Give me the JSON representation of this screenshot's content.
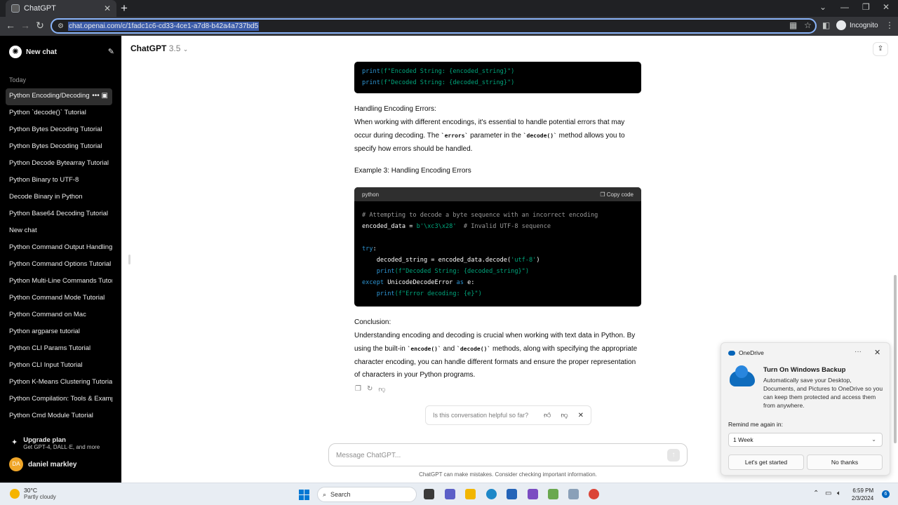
{
  "browser": {
    "tab_title": "ChatGPT",
    "url": "chat.openai.com/c/1fadc1c6-cd33-4ce1-a7d8-b42a4a737bd5",
    "incognito_label": "Incognito"
  },
  "sidebar": {
    "new_chat": "New chat",
    "section": "Today",
    "items": [
      "Python Encoding/Decoding",
      "Python `decode()` Tutorial",
      "Python Bytes Decoding Tutorial",
      "Python Bytes Decoding Tutorial",
      "Python Decode Bytearray Tutorial",
      "Python Binary to UTF-8",
      "Decode Binary in Python",
      "Python Base64 Decoding Tutorial",
      "New chat",
      "Python Command Output Handling",
      "Python Command Options Tutorial",
      "Python Multi-Line Commands Tutorial",
      "Python Command Mode Tutorial",
      "Python Command on Mac",
      "Python argparse tutorial",
      "Python CLI Params Tutorial",
      "Python CLI Input Tutorial",
      "Python K-Means Clustering Tutorial",
      "Python Compilation: Tools & Examples",
      "Python Cmd Module Tutorial"
    ],
    "upgrade_title": "Upgrade plan",
    "upgrade_sub": "Get GPT-4, DALL·E, and more",
    "user_initials": "DA",
    "user_name": "daniel markley"
  },
  "header": {
    "model": "ChatGPT",
    "version": "3.5"
  },
  "chat": {
    "code_top": {
      "line1_fn": "print",
      "line1_str": "(f\"Encoded String: {encoded_string}\")",
      "line2_fn": "print",
      "line2_str": "(f\"Decoded String: {decoded_string}\")"
    },
    "heading_errors": "Handling Encoding Errors:",
    "para_errors_1": "When working with different encodings, it's essential to handle potential errors that may occur during decoding. The ",
    "code_errors": "`errors`",
    "para_errors_2": " parameter in the ",
    "code_decode": "`decode()`",
    "para_errors_3": " method allows you to specify how errors should be handled.",
    "example3": "Example 3: Handling Encoding Errors",
    "code_block": {
      "language": "python",
      "copy_label": "Copy code",
      "comment": "# Attempting to decode a byte sequence with an incorrect encoding",
      "l2_var": "encoded_data = ",
      "l2_str": "b'\\xc3\\x28'",
      "l2_cm": "  # Invalid UTF-8 sequence",
      "l4_kw": "try",
      "l4_rest": ":",
      "l5_a": "    decoded_string = encoded_data.decode(",
      "l5_str": "'utf-8'",
      "l5_b": ")",
      "l6_fn": "    print",
      "l6_str": "(f\"Decoded String: {decoded_string}\")",
      "l7_kw": "except",
      "l7_mid": " UnicodeDecodeError ",
      "l7_kw2": "as",
      "l7_end": " e:",
      "l8_fn": "    print",
      "l8_str": "(f\"Error decoding: {e}\")"
    },
    "conclusion": "Conclusion:",
    "concl_1": "Understanding encoding and decoding is crucial when working with text data in Python. By using the built-in ",
    "concl_code1": "`encode()`",
    "concl_2": " and ",
    "concl_code2": "`decode()`",
    "concl_3": " methods, along with specifying the appropriate character encoding, you can handle different formats and ensure the proper representation of characters in your Python programs."
  },
  "feedback": {
    "question": "Is this conversation helpful so far?"
  },
  "composer": {
    "placeholder": "Message ChatGPT...",
    "disclaimer": "ChatGPT can make mistakes. Consider checking important information."
  },
  "toast": {
    "app": "OneDrive",
    "title": "Turn On Windows Backup",
    "body": "Automatically save your Desktop, Documents, and Pictures to OneDrive so you can keep them protected and access them from anywhere.",
    "remind_label": "Remind me again in:",
    "remind_value": "1 Week",
    "primary": "Let's get started",
    "secondary": "No thanks"
  },
  "taskbar": {
    "temp": "30°C",
    "weather": "Partly cloudy",
    "search": "Search",
    "time": "6:59 PM",
    "date": "2/3/2024",
    "notifications": "6"
  }
}
